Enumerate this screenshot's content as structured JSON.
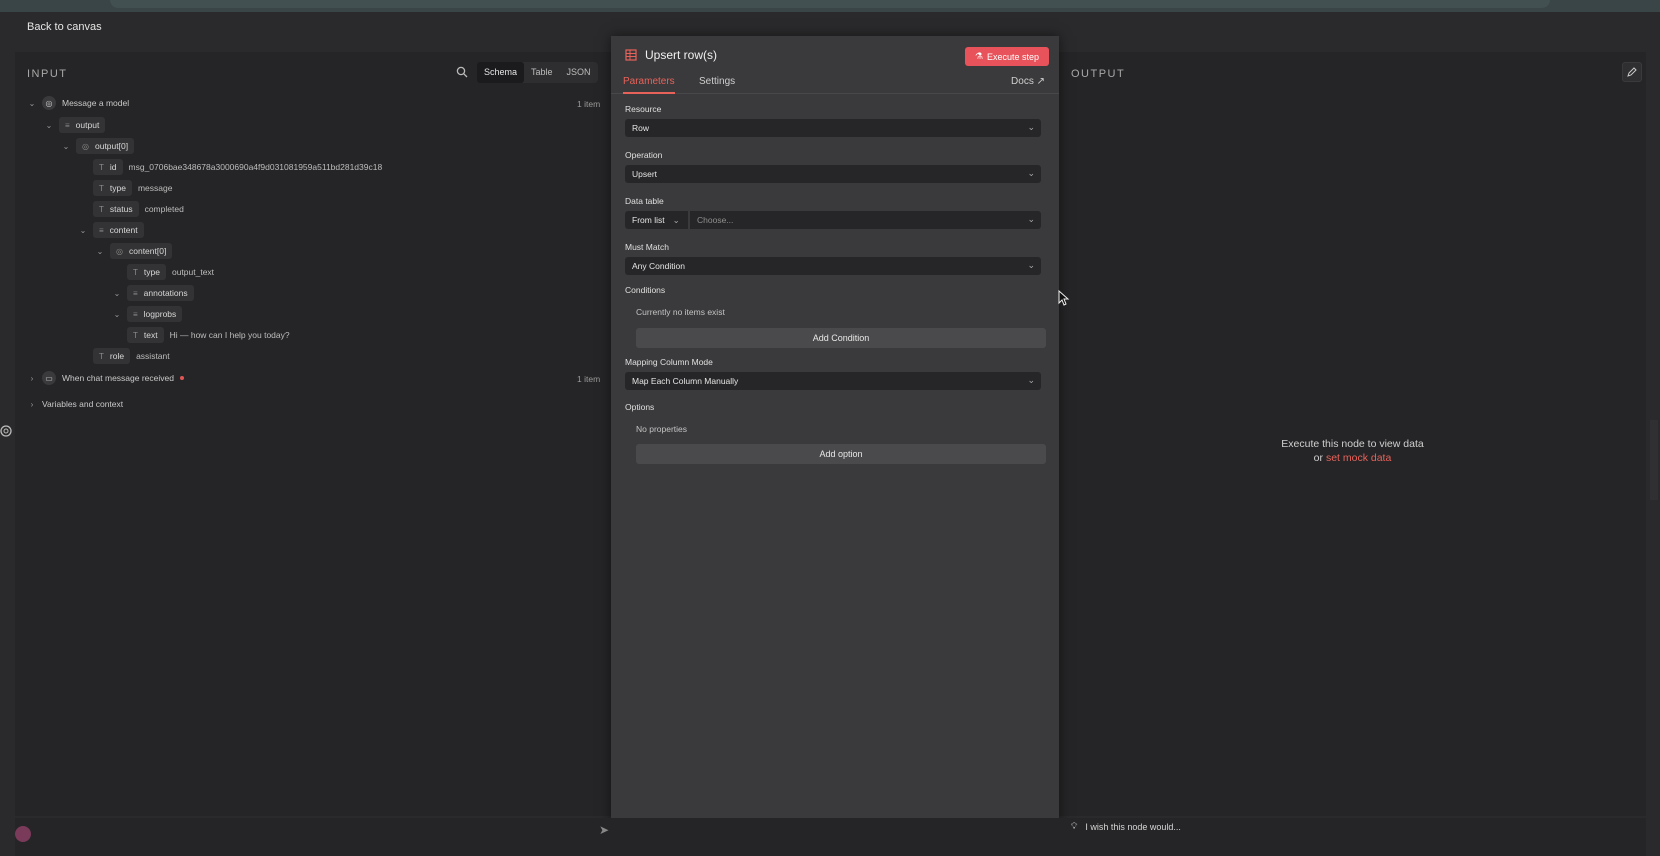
{
  "header": {
    "back_label": "Back to canvas"
  },
  "input": {
    "label": "INPUT",
    "view_tabs": [
      "Schema",
      "Table",
      "JSON"
    ],
    "tree": {
      "message_model": "Message a model",
      "message_model_count": "1 item",
      "output": "output",
      "output0": "output[0]",
      "id_key": "id",
      "id_val": "msg_0706bae348678a3000690a4f9d031081959a511bd281d39c18",
      "type_key": "type",
      "type_val": "message",
      "status_key": "status",
      "status_val": "completed",
      "content": "content",
      "content0": "content[0]",
      "ctype_key": "type",
      "ctype_val": "output_text",
      "annotations": "annotations",
      "logprobs": "logprobs",
      "text_key": "text",
      "text_val": "Hi — how can I help you today?",
      "role_key": "role",
      "role_val": "assistant",
      "chat_trigger": "When chat message received",
      "chat_trigger_count": "1 item",
      "vars": "Variables and context"
    }
  },
  "modal": {
    "title": "Upsert row(s)",
    "execute_label": "Execute step",
    "tabs": [
      "Parameters",
      "Settings"
    ],
    "docs_label": "Docs",
    "fields": {
      "resource_label": "Resource",
      "resource_value": "Row",
      "operation_label": "Operation",
      "operation_value": "Upsert",
      "datatable_label": "Data table",
      "datatable_mode": "From list",
      "datatable_placeholder": "Choose...",
      "mustmatch_label": "Must Match",
      "mustmatch_value": "Any Condition",
      "conditions_label": "Conditions",
      "conditions_empty": "Currently no items exist",
      "add_condition": "Add Condition",
      "mapping_label": "Mapping Column Mode",
      "mapping_value": "Map Each Column Manually",
      "options_label": "Options",
      "options_empty": "No properties",
      "add_option": "Add option"
    }
  },
  "output": {
    "label": "OUTPUT",
    "empty_line1": "Execute this node to view data",
    "empty_or": "or",
    "empty_link": "set mock data"
  },
  "footer": {
    "wish_label": "I wish this node would..."
  },
  "colors": {
    "accent": "#e8525a",
    "panel": "#252527",
    "modal": "#3a3a3c"
  }
}
